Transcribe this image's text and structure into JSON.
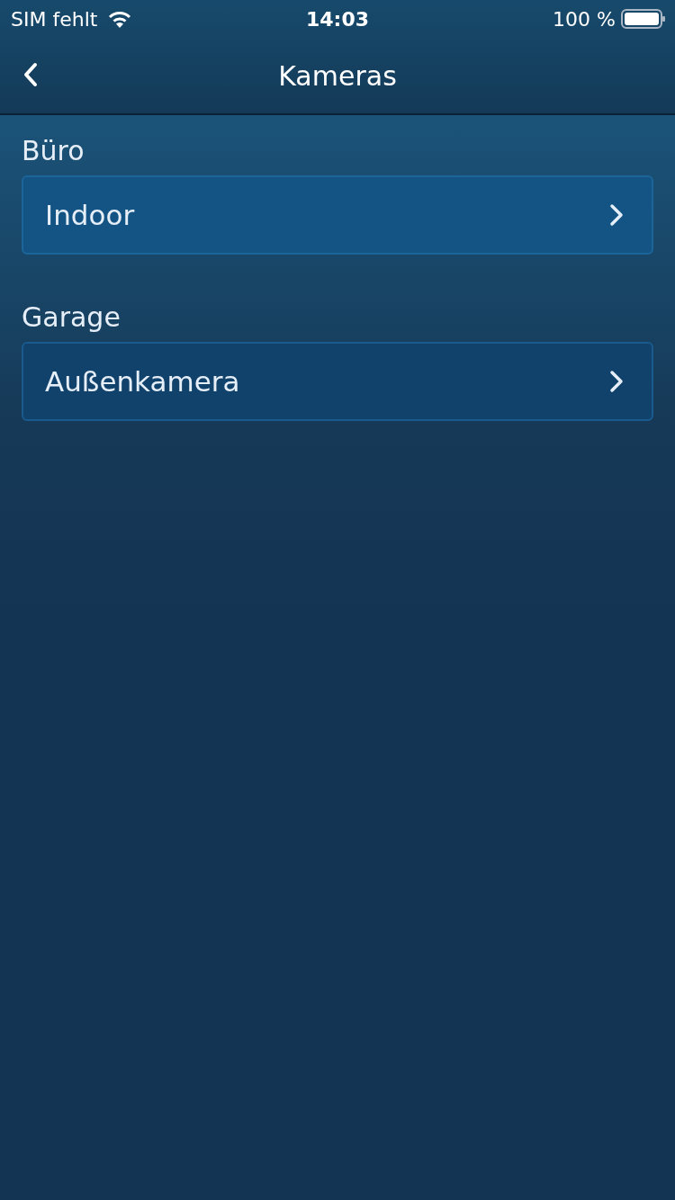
{
  "status_bar": {
    "carrier": "SIM fehlt",
    "time": "14:03",
    "battery": "100 %"
  },
  "nav_bar": {
    "title": "Kameras"
  },
  "sections": [
    {
      "title": "Büro",
      "items": [
        {
          "label": "Indoor"
        }
      ]
    },
    {
      "title": "Garage",
      "items": [
        {
          "label": "Außenkamera"
        }
      ]
    }
  ]
}
